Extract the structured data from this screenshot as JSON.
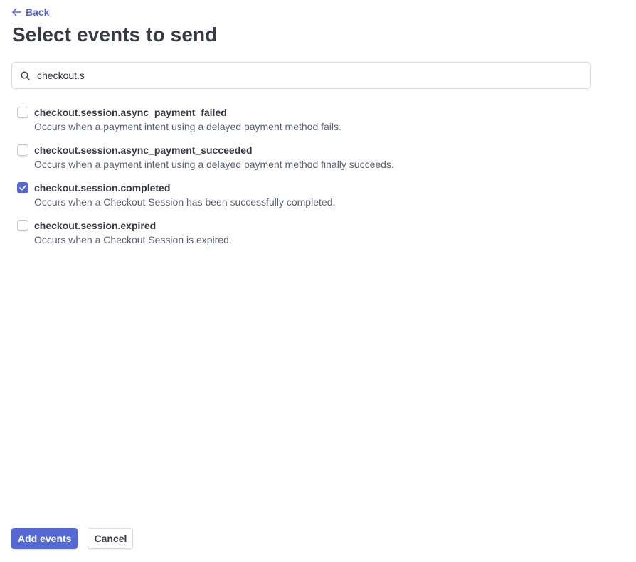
{
  "nav": {
    "back_label": "Back",
    "back_icon": "arrow-left-icon"
  },
  "page": {
    "title": "Select events to send"
  },
  "search": {
    "value": "checkout.s",
    "placeholder": "",
    "icon": "search-icon"
  },
  "events": [
    {
      "name": "checkout.session.async_payment_failed",
      "description": "Occurs when a payment intent using a delayed payment method fails.",
      "checked": false
    },
    {
      "name": "checkout.session.async_payment_succeeded",
      "description": "Occurs when a payment intent using a delayed payment method finally succeeds.",
      "checked": false
    },
    {
      "name": "checkout.session.completed",
      "description": "Occurs when a Checkout Session has been successfully completed.",
      "checked": true
    },
    {
      "name": "checkout.session.expired",
      "description": "Occurs when a Checkout Session is expired.",
      "checked": false
    }
  ],
  "footer": {
    "add_label": "Add events",
    "cancel_label": "Cancel"
  },
  "colors": {
    "accent": "#5469d4",
    "text": "#353a44",
    "muted": "#596171",
    "border": "#d5dbe1"
  }
}
